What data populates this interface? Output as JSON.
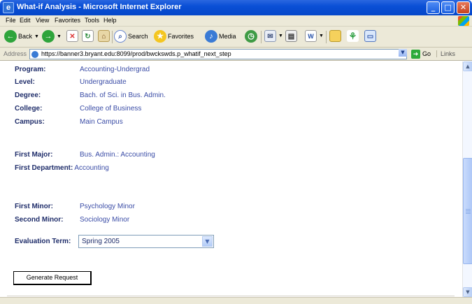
{
  "window": {
    "title": "What-if Analysis - Microsoft Internet Explorer",
    "app_icon": "e",
    "buttons": {
      "minimize": "_",
      "maximize": "□",
      "close": "✕"
    }
  },
  "menu": [
    "File",
    "Edit",
    "View",
    "Favorites",
    "Tools",
    "Help"
  ],
  "toolbar": {
    "back": "Back",
    "search": "Search",
    "favorites": "Favorites",
    "media": "Media"
  },
  "address": {
    "label": "Address",
    "url": "https://banner3.bryant.edu:8099/prod/bwckswds.p_whatif_next_step",
    "go": "Go",
    "links": "Links"
  },
  "fields": {
    "program": {
      "label": "Program:",
      "value": "Accounting-Undergrad"
    },
    "level": {
      "label": "Level:",
      "value": "Undergraduate"
    },
    "degree": {
      "label": "Degree:",
      "value": "Bach. of Sci. in Bus. Admin."
    },
    "college": {
      "label": "College:",
      "value": "College of Business"
    },
    "campus": {
      "label": "Campus:",
      "value": "Main Campus"
    },
    "first_major": {
      "label": "First Major:",
      "value": "Bus. Admin.: Accounting"
    },
    "first_dept": {
      "label": "First Department:",
      "value": "Accounting"
    },
    "first_minor": {
      "label": "First Minor:",
      "value": "Psychology Minor"
    },
    "second_minor": {
      "label": "Second Minor:",
      "value": "Sociology Minor"
    }
  },
  "evaluation_term": {
    "label": "Evaluation Term:",
    "selected": "Spring 2005"
  },
  "generate_button": "Generate Request",
  "colors": {
    "label_text": "#1f2d6a",
    "value_text": "#3a4ca6",
    "titlebar": "#0a4fd6",
    "chrome": "#ece9d8"
  }
}
